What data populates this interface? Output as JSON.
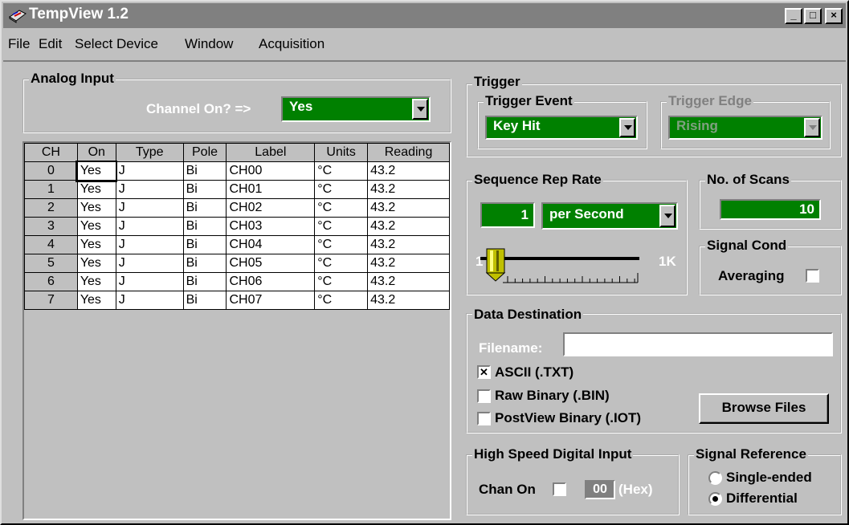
{
  "window": {
    "title": "TempView 1.2",
    "minimize": "_",
    "maximize": "□",
    "close": "×"
  },
  "menu": [
    "File",
    "Edit",
    "Select Device",
    "Window",
    "Acquisition"
  ],
  "analog_input": {
    "title": "Analog Input",
    "channel_on_label": "Channel On? =>",
    "channel_on_value": "Yes",
    "columns": [
      "CH",
      "On",
      "Type",
      "Pole",
      "Label",
      "Units",
      "Reading"
    ],
    "rows": [
      [
        "0",
        "Yes",
        "J",
        "Bi",
        "CH00",
        "°C",
        "43.2"
      ],
      [
        "1",
        "Yes",
        "J",
        "Bi",
        "CH01",
        "°C",
        "43.2"
      ],
      [
        "2",
        "Yes",
        "J",
        "Bi",
        "CH02",
        "°C",
        "43.2"
      ],
      [
        "3",
        "Yes",
        "J",
        "Bi",
        "CH03",
        "°C",
        "43.2"
      ],
      [
        "4",
        "Yes",
        "J",
        "Bi",
        "CH04",
        "°C",
        "43.2"
      ],
      [
        "5",
        "Yes",
        "J",
        "Bi",
        "CH05",
        "°C",
        "43.2"
      ],
      [
        "6",
        "Yes",
        "J",
        "Bi",
        "CH06",
        "°C",
        "43.2"
      ],
      [
        "7",
        "Yes",
        "J",
        "Bi",
        "CH07",
        "°C",
        "43.2"
      ]
    ]
  },
  "trigger": {
    "title": "Trigger",
    "event_title": "Trigger Event",
    "event_value": "Key Hit",
    "edge_title": "Trigger Edge",
    "edge_value": "Rising"
  },
  "sequence": {
    "title": "Sequence Rep Rate",
    "rate_value": "1",
    "rate_unit": "per Second",
    "slider_min": "1",
    "slider_max": "1K"
  },
  "scans": {
    "title": "No. of Scans",
    "value": "10"
  },
  "signal_cond": {
    "title": "Signal Cond",
    "averaging_label": "Averaging"
  },
  "data_destination": {
    "title": "Data Destination",
    "filename_label": "Filename:",
    "filename_value": "",
    "ascii_label": "ASCII (.TXT)",
    "ascii_checked_mark": "✕",
    "raw_label": "Raw Binary (.BIN)",
    "postview_label": "PostView Binary (.IOT)",
    "browse_label": "Browse Files"
  },
  "hs_digital": {
    "title": "High Speed Digital Input",
    "chan_on_label": "Chan On",
    "hex_value": "00",
    "hex_label": "(Hex)"
  },
  "signal_reference": {
    "title": "Signal Reference",
    "single_label": "Single-ended",
    "diff_label": "Differential"
  },
  "colors": {
    "field_green": "#008000",
    "face": "#c0c0c0",
    "disabled_text": "#808080"
  }
}
